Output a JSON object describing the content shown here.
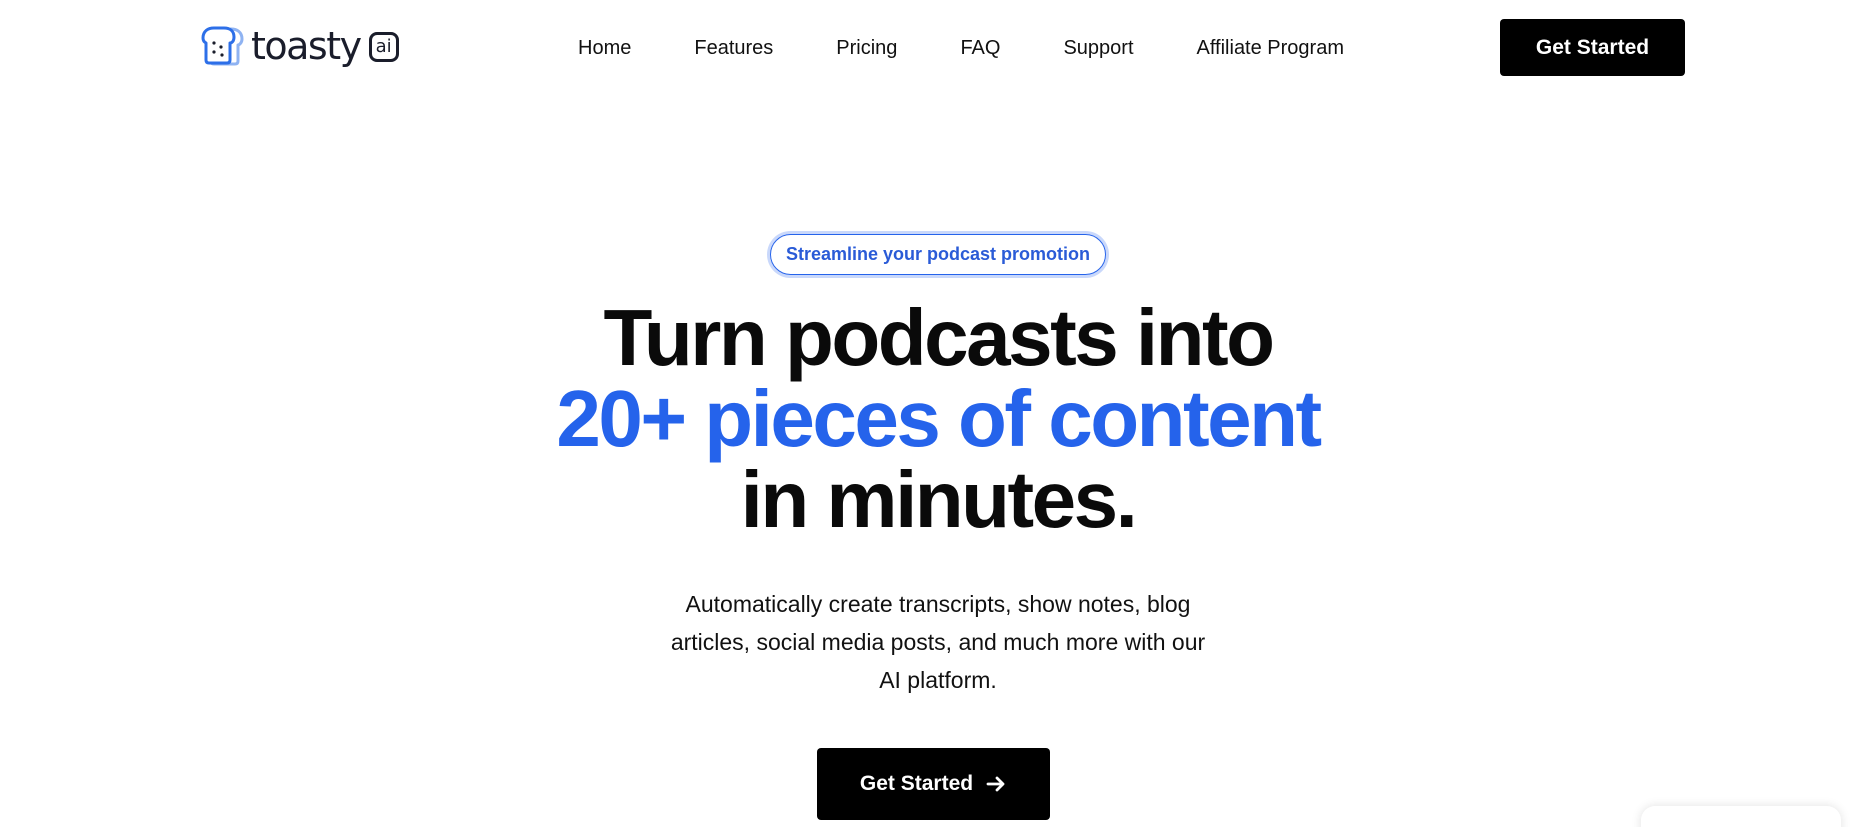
{
  "header": {
    "logo": {
      "text": "toasty",
      "badge": "ai",
      "icon": "toast-bread-icon"
    },
    "nav": [
      {
        "label": "Home"
      },
      {
        "label": "Features"
      },
      {
        "label": "Pricing"
      },
      {
        "label": "FAQ"
      },
      {
        "label": "Support"
      },
      {
        "label": "Affiliate Program"
      }
    ],
    "cta_label": "Get Started"
  },
  "hero": {
    "badge": "Streamline your podcast promotion",
    "headline": {
      "line1": "Turn podcasts into",
      "line2": "20+ pieces of content",
      "line3": "in minutes."
    },
    "subtext": {
      "line1": "Automatically create transcripts, show notes, blog",
      "line2": "articles, social media posts, and much more with our",
      "line3": "AI platform."
    },
    "cta_label": "Get Started",
    "cta_icon": "arrow-right-icon"
  },
  "colors": {
    "accent": "#2563eb",
    "button_bg": "#000000",
    "text": "#111111",
    "background": "#ffffff"
  }
}
